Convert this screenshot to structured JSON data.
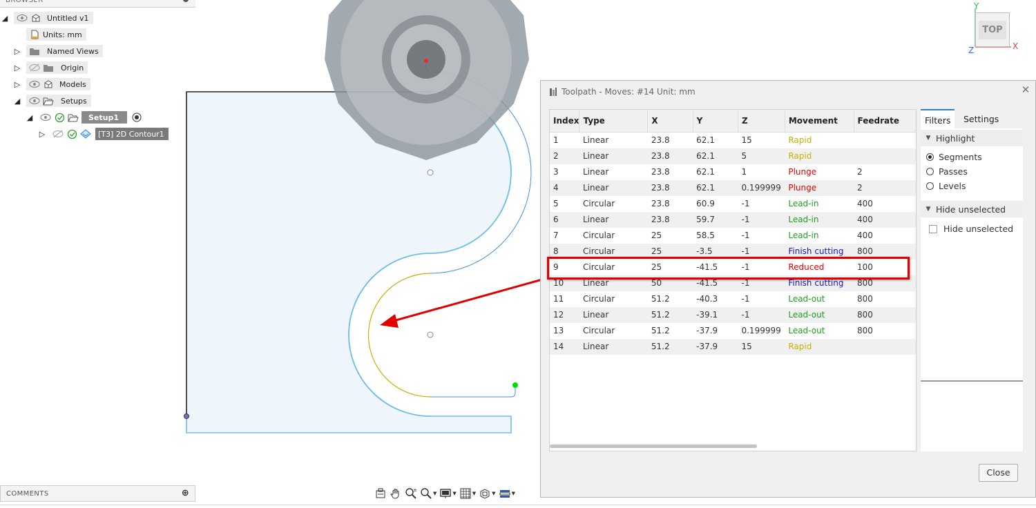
{
  "browser": {
    "header": "BROWSER",
    "root": "Untitled v1",
    "units": "Units: mm",
    "named_views": "Named Views",
    "origin": "Origin",
    "models": "Models",
    "setups": "Setups",
    "setup1": "Setup1",
    "operation": "[T3] 2D Contour1"
  },
  "viewcube": {
    "face": "TOP",
    "x": "X",
    "y": "Y",
    "z": "Z"
  },
  "dialog": {
    "title": "Toolpath - Moves: #14 Unit: mm",
    "columns": [
      "Index",
      "Type",
      "X",
      "Y",
      "Z",
      "Movement",
      "Feedrate"
    ],
    "rows": [
      [
        "1",
        "Linear",
        "23.8",
        "62.1",
        "15",
        "Rapid",
        ""
      ],
      [
        "2",
        "Linear",
        "23.8",
        "62.1",
        "5",
        "Rapid",
        ""
      ],
      [
        "3",
        "Linear",
        "23.8",
        "62.1",
        "1",
        "Plunge",
        "2"
      ],
      [
        "4",
        "Linear",
        "23.8",
        "62.1",
        "0.199999",
        "Plunge",
        "2"
      ],
      [
        "5",
        "Circular",
        "23.8",
        "60.9",
        "-1",
        "Lead-in",
        "400"
      ],
      [
        "6",
        "Linear",
        "23.8",
        "59.7",
        "-1",
        "Lead-in",
        "400"
      ],
      [
        "7",
        "Circular",
        "25",
        "58.5",
        "-1",
        "Lead-in",
        "400"
      ],
      [
        "8",
        "Circular",
        "25",
        "-3.5",
        "-1",
        "Finish cutting",
        "800"
      ],
      [
        "9",
        "Circular",
        "25",
        "-41.5",
        "-1",
        "Reduced",
        "100"
      ],
      [
        "10",
        "Linear",
        "50",
        "-41.5",
        "-1",
        "Finish cutting",
        "800"
      ],
      [
        "11",
        "Circular",
        "51.2",
        "-40.3",
        "-1",
        "Lead-out",
        "800"
      ],
      [
        "12",
        "Linear",
        "51.2",
        "-39.1",
        "-1",
        "Lead-out",
        "800"
      ],
      [
        "13",
        "Circular",
        "51.2",
        "-37.9",
        "0.199999",
        "Lead-out",
        "800"
      ],
      [
        "14",
        "Linear",
        "51.2",
        "-37.9",
        "15",
        "Rapid",
        ""
      ]
    ],
    "movement_colors": {
      "Rapid": "#c8b000",
      "Plunge": "#e00000",
      "Lead-in": "#1ca01c",
      "Lead-out": "#1ca01c",
      "Finish cutting": "#1515c8",
      "Reduced": "#e00000"
    },
    "highlighted_row": "9",
    "highlight_color": "#e00000",
    "tabs": [
      "Filters",
      "Settings"
    ],
    "highlight_section": "Highlight",
    "highlight_options": [
      "Segments",
      "Passes",
      "Levels"
    ],
    "selected_highlight": "Segments",
    "hide_section": "Hide unselected",
    "hide_checkbox": "Hide unselected",
    "hide_checked": false,
    "close_label": "Close"
  },
  "comments": {
    "label": "COMMENTS"
  },
  "colors": {
    "stock_fill": "#eef6fc",
    "toolpath_blue": "#6cbde6",
    "toolpath_yellow": "#c8b000",
    "tool_gray": "#8a9096",
    "arrow_red": "#e00000"
  }
}
